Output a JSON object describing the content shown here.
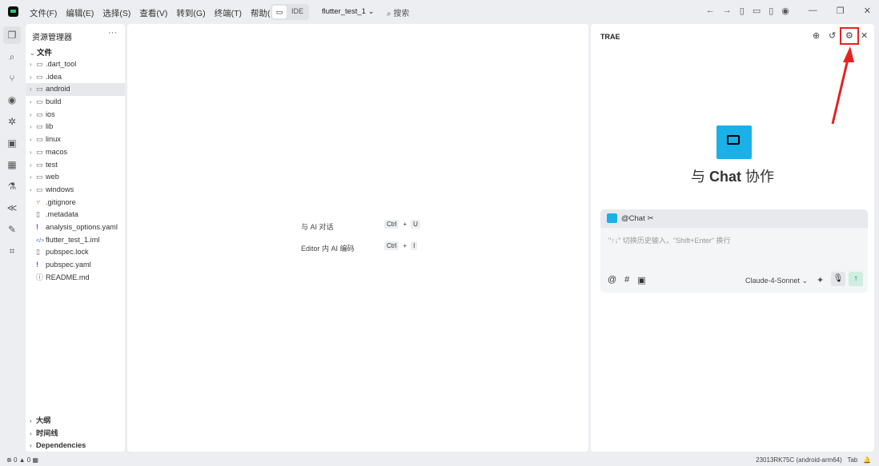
{
  "titlebar": {
    "menus": [
      "文件(F)",
      "编辑(E)",
      "选择(S)",
      "查看(V)",
      "转到(G)",
      "终端(T)",
      "帮助(H)"
    ],
    "ide_label": "IDE",
    "project": "flutter_test_1",
    "search": "搜索"
  },
  "sidebar": {
    "title": "资源管理器",
    "section": "文件",
    "items": [
      ".dart_tool",
      ".idea",
      "android",
      "build",
      "ios",
      "lib",
      "linux",
      "macos",
      "test",
      "web",
      "windows",
      ".gitignore",
      ".metadata",
      "analysis_options.yaml",
      "flutter_test_1.iml",
      "pubspec.lock",
      "pubspec.yaml",
      "README.md"
    ],
    "bottom": [
      "大纲",
      "时间线",
      "Dependencies"
    ]
  },
  "editor": {
    "hint1": "与 AI 对话",
    "hint1_keys": [
      "Ctrl",
      "+",
      "U"
    ],
    "hint2": "Editor 内 AI 编码",
    "hint2_keys": [
      "Ctrl",
      "+",
      "I"
    ]
  },
  "chat": {
    "title": "TRAE",
    "heading_pre": "与 ",
    "heading_bold": "Chat",
    "heading_post": " 协作",
    "agent": "@Chat",
    "placeholder": "\"↑↓\" 切换历史输入，\"Shift+Enter\" 换行",
    "model": "Claude-4-Sonnet"
  },
  "status": {
    "errors": "0",
    "warnings": "0",
    "device": "23013RK75C (android-arm64)",
    "indent": "Tab"
  },
  "colors": {
    "accent": "#1ab0e8",
    "highlight": "#e52222"
  }
}
